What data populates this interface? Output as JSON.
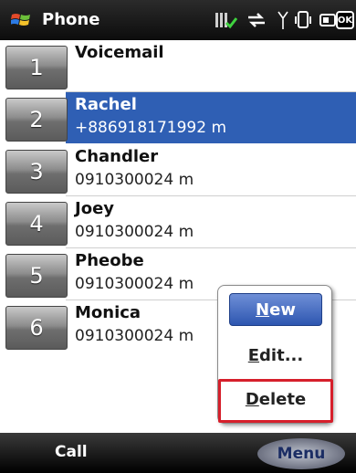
{
  "titlebar": {
    "title": "Phone",
    "ok_label": "OK",
    "icons": [
      "windows-logo-icon",
      "signal-data-icon",
      "sync-arrows-icon",
      "antenna-icon",
      "vibrate-icon",
      "battery-icon"
    ]
  },
  "contacts": [
    {
      "key": "1",
      "name": "Voicemail",
      "number": ""
    },
    {
      "key": "2",
      "name": "Rachel",
      "number": "+886918171992 m",
      "selected": true
    },
    {
      "key": "3",
      "name": "Chandler",
      "number": "0910300024 m"
    },
    {
      "key": "4",
      "name": "Joey",
      "number": "0910300024 m"
    },
    {
      "key": "5",
      "name": "Pheobe",
      "number": "0910300024 m"
    },
    {
      "key": "6",
      "name": "Monica",
      "number": "0910300024 m"
    }
  ],
  "menu": {
    "items": [
      {
        "label_ul": "N",
        "label_rest": "ew"
      },
      {
        "label_ul": "E",
        "label_rest": "dit..."
      },
      {
        "label_ul": "D",
        "label_rest": "elete"
      }
    ]
  },
  "softkeys": {
    "left": "Call",
    "right": "Menu"
  },
  "colors": {
    "selection": "#2f5fb4",
    "highlight_outline": "#d61f2b"
  }
}
